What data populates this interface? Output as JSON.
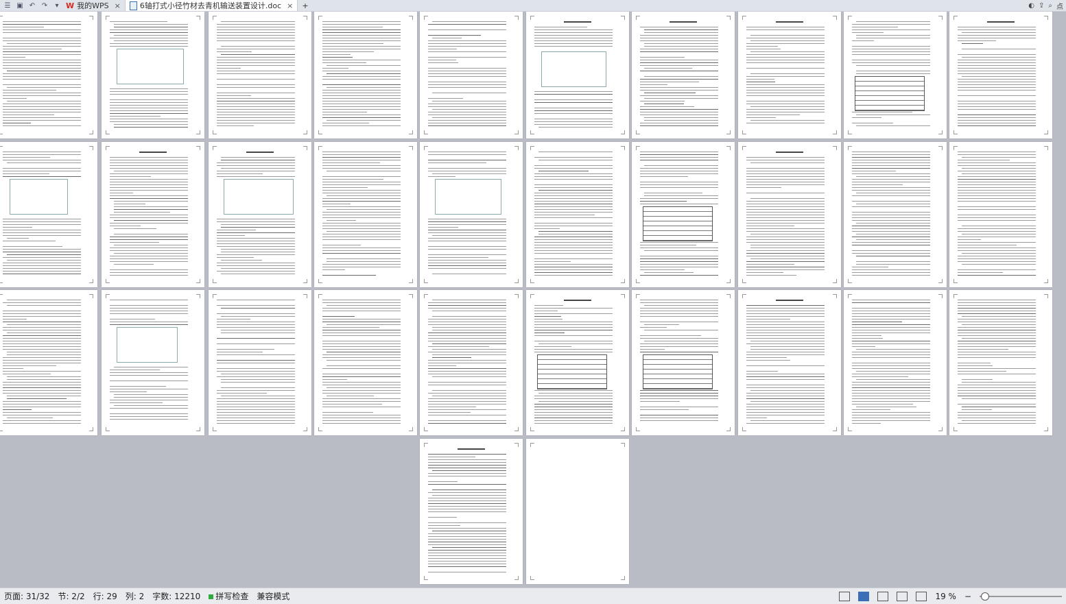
{
  "app": {
    "tabs": [
      {
        "label": "我的WPS",
        "active": false
      },
      {
        "label": "6轴打式小径竹材去青机输送装置设计.doc",
        "active": true
      }
    ],
    "new_tab": "+",
    "close": "×",
    "right_label": "点"
  },
  "status": {
    "page": "页面: 31/32",
    "section": "节: 2/2",
    "row": "行: 29",
    "col": "列: 2",
    "words": "字数: 12210",
    "spell": "拼写检查",
    "compat": "兼容模式",
    "zoom": "19 %",
    "zoom_level_percent": 19
  },
  "pages": {
    "count": 32,
    "rows": [
      10,
      10,
      10,
      2
    ]
  }
}
